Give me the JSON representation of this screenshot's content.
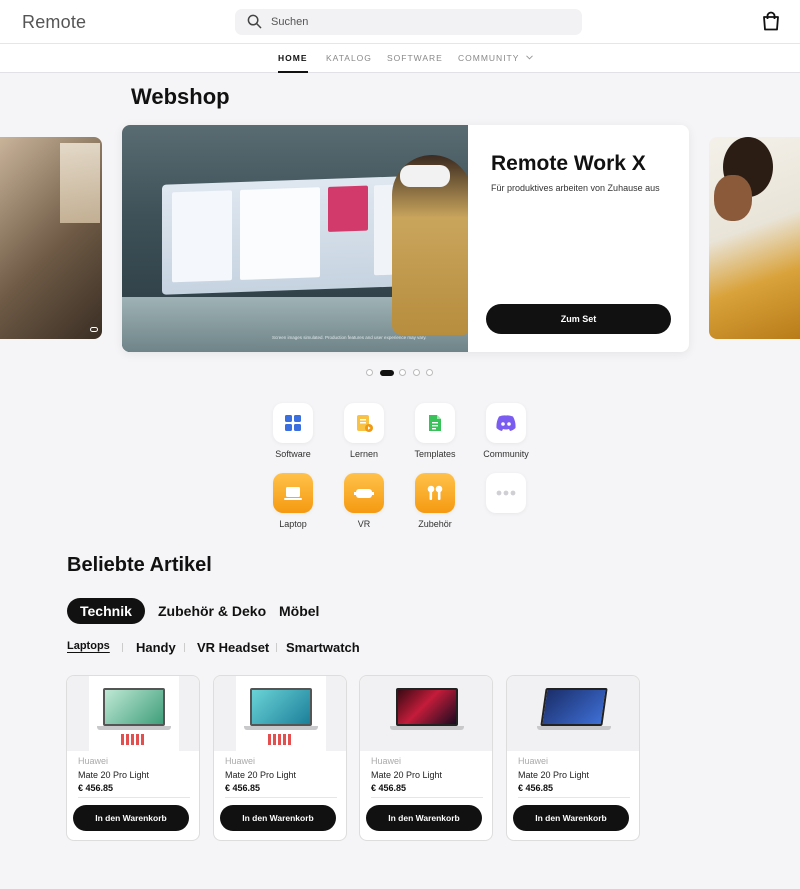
{
  "header": {
    "logo": "Remote",
    "search_placeholder": "Suchen"
  },
  "nav": {
    "items": [
      {
        "label": "HOME",
        "active": true
      },
      {
        "label": "KATALOG"
      },
      {
        "label": "SOFTWARE"
      },
      {
        "label": "COMMUNITY",
        "has_dropdown": true
      }
    ]
  },
  "page": {
    "title": "Webshop"
  },
  "hero": {
    "title": "Remote Work X",
    "subtitle": "Für produktives arbeiten von Zuhause aus",
    "button": "Zum Set",
    "image_caption": "Screen images simulated. Production features and user experience may vary.",
    "active_slide": 2,
    "slide_count": 5
  },
  "categories": [
    {
      "label": "Software",
      "icon": "grid-icon",
      "color": "#3b6fe0"
    },
    {
      "label": "Lernen",
      "icon": "learning-icon",
      "color": "#f2a516"
    },
    {
      "label": "Templates",
      "icon": "document-icon",
      "color": "#3ac25a"
    },
    {
      "label": "Community",
      "icon": "discord-icon",
      "color": "#7b5cf0"
    },
    {
      "label": "Laptop",
      "icon": "laptop-icon",
      "color": "#f8a91c"
    },
    {
      "label": "VR",
      "icon": "vr-headset-icon",
      "color": "#f8a91c"
    },
    {
      "label": "Zubehör",
      "icon": "earbuds-icon",
      "color": "#f8a91c"
    },
    {
      "label": "",
      "icon": "more-icon",
      "color": "#cccccc"
    }
  ],
  "popular": {
    "title": "Beliebte Artikel",
    "tabs": [
      "Technik",
      "Zubehör & Deko",
      "Möbel"
    ],
    "subtabs": [
      "Laptops",
      "Handy",
      "VR Headset",
      "Smartwatch"
    ]
  },
  "products": [
    {
      "brand": "Huawei",
      "name": "Mate 20 Pro Light",
      "price": "€ 456.85",
      "button": "In den Warenkorb"
    },
    {
      "brand": "Huawei",
      "name": "Mate 20 Pro Light",
      "price": "€ 456.85",
      "button": "In den Warenkorb"
    },
    {
      "brand": "Huawei",
      "name": "Mate 20 Pro Light",
      "price": "€ 456.85",
      "button": "In den Warenkorb"
    },
    {
      "brand": "Huawei",
      "name": "Mate 20 Pro Light",
      "price": "€ 456.85",
      "button": "In den Warenkorb"
    }
  ]
}
